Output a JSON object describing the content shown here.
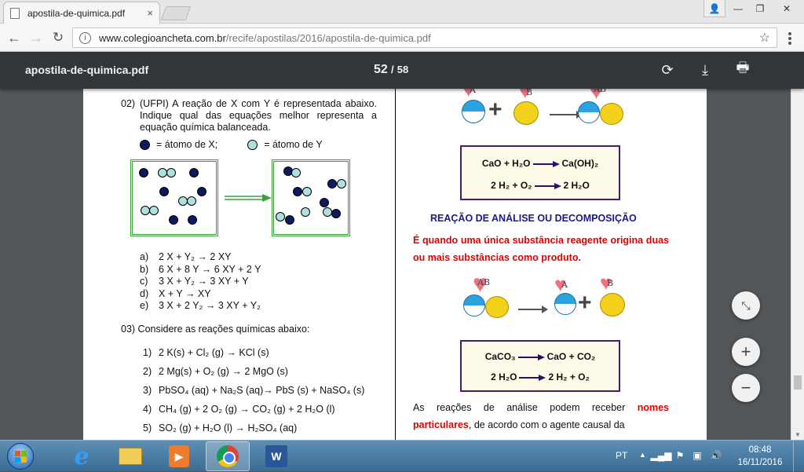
{
  "browser": {
    "tab_title": "apostila-de-quimica.pdf",
    "tab_close": "×",
    "url_host": "www.colegioancheta.com.br",
    "url_path": "/recife/apostilas/2016/apostila-de-quimica.pdf"
  },
  "pdf_toolbar": {
    "title": "apostila-de-quimica.pdf",
    "current_page": "52",
    "separator": "/",
    "total_pages": "58"
  },
  "left": {
    "q2_number": "02)",
    "q2_text": "(UFPI) A reação de X com Y é representada abaixo. Indique qual das equações melhor representa a equação química balanceada.",
    "legend_x": "= átomo de X;",
    "legend_y": "= átomo de Y",
    "options": [
      {
        "letter": "a)",
        "eq": "2 X + Y₂ → 2 XY"
      },
      {
        "letter": "b)",
        "eq": "6 X + 8 Y → 6 XY + 2 Y"
      },
      {
        "letter": "c)",
        "eq": "3 X + Y₂ → 3 XY + Y"
      },
      {
        "letter": "d)",
        "eq": "X + Y → XY"
      },
      {
        "letter": "e)",
        "eq": "3 X + 2 Y₂ → 3 XY + Y₂"
      }
    ],
    "q3_text": "03) Considere as reações químicas abaixo:",
    "reactions": [
      {
        "n": "1)",
        "eq": "2 K(s) + Cl₂ (g) → KCl (s)"
      },
      {
        "n": "2)",
        "eq": "2 Mg(s) + O₂ (g) → 2 MgO (s)"
      },
      {
        "n": "3)",
        "eq": "PbSO₄ (aq) + Na₂S (aq)→ PbS (s) + NaSO₄ (s)"
      },
      {
        "n": "4)",
        "eq": "CH₄ (g) + 2 O₂ (g) → CO₂ (g) + 2 H₂O (l)"
      },
      {
        "n": "5)",
        "eq": "SO₂ (g) + H₂O (l) → H₂SO₄ (aq)"
      }
    ]
  },
  "right": {
    "synth_labels": {
      "a": "A",
      "b": "B",
      "ab": "AB"
    },
    "synth_eq1_left": "CaO + H₂O",
    "synth_eq1_right": "Ca(OH)₂",
    "synth_eq2_left": "2 H₂ + O₂",
    "synth_eq2_right": "2 H₂O",
    "section_title": "REAÇÃO DE ANÁLISE OU DECOMPOSIÇÃO",
    "definition": "É quando uma única substância reagente origina duas ou mais substâncias como produto.",
    "decomp_eq1_left": "CaCO₃",
    "decomp_eq1_right": "CaO + CO₂",
    "decomp_eq2_left": "2 H₂O",
    "decomp_eq2_right": "2 H₂ + O₂",
    "body_prefix": "As reações de análise podem receber ",
    "body_red": "nomes particulares",
    "body_suffix": ", de acordo com o agente causal da"
  },
  "taskbar": {
    "language": "PT",
    "time": "08:48",
    "date": "16/11/2016"
  },
  "colors": {
    "atom_x": "#0d1a5e",
    "atom_y": "#aee0de",
    "box_border": "#3ba03b",
    "eq_border": "#4b1b6b",
    "section_title": "#1a1a8a",
    "emphasis_red": "#e00000"
  }
}
